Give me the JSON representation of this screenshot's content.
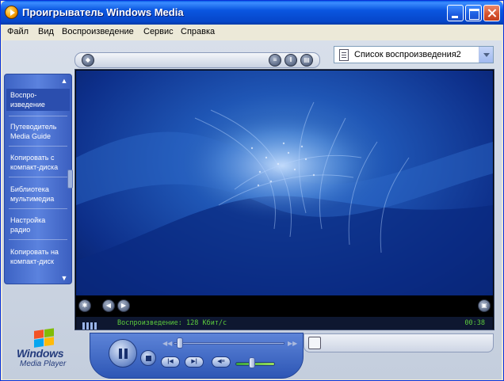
{
  "window": {
    "title": "Проигрыватель Windows Media"
  },
  "menu": [
    {
      "label": "Файл"
    },
    {
      "label": "Вид"
    },
    {
      "label": "Воспроизведение"
    },
    {
      "label": "Сервис"
    },
    {
      "label": "Справка"
    }
  ],
  "playlist": {
    "selected": "Список воспроизведения2"
  },
  "nav": {
    "items": [
      {
        "label": "Воспро-\nизведение",
        "active": true
      },
      {
        "label": "Путеводитель\nMedia Guide",
        "active": false
      },
      {
        "label": "Копировать с\nкомпакт-диска",
        "active": false
      },
      {
        "label": "Библиотека\nмультимедиа",
        "active": false
      },
      {
        "label": "Настройка\nрадио",
        "active": false
      },
      {
        "label": "Копировать на\nкомпакт-диск",
        "active": false
      }
    ]
  },
  "status": {
    "text": "Воспроизведение: 128 Кбит/с",
    "time": "00:38"
  },
  "logo": {
    "line1": "Windows",
    "line2": "Media Player"
  },
  "colors": {
    "titlebar": "#0a56e0",
    "nav": "#4a70d0",
    "status_text": "#5dcc3d",
    "video_bg": "#0d2f8a"
  },
  "playback": {
    "seek_fraction": 0.03,
    "volume_fraction": 0.4
  }
}
